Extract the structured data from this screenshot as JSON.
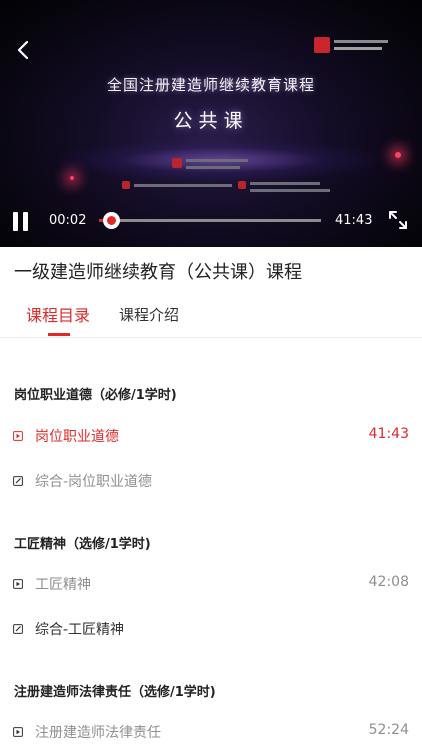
{
  "player": {
    "video_title": "全国注册建造师继续教育课程",
    "video_subtitle": "公共课",
    "current_time": "00:02",
    "total_time": "41:43",
    "progress": 0.01,
    "accent_color": "#e02a2a",
    "icons": {
      "back": "back-arrow-icon",
      "pause": "pause-icon",
      "fullscreen": "fullscreen-icon"
    }
  },
  "course": {
    "title": "一级建造师继续教育（公共课）课程"
  },
  "tabs": [
    {
      "label": "课程目录",
      "active": true
    },
    {
      "label": "课程介绍",
      "active": false
    }
  ],
  "sections": [
    {
      "title": "岗位职业道德（必修/1学时)",
      "lessons": [
        {
          "type": "video",
          "name": "岗位职业道德",
          "duration": "41:43",
          "active": true
        },
        {
          "type": "exam",
          "name": "综合-岗位职业道德",
          "duration": ""
        }
      ]
    },
    {
      "title": "工匠精神（选修/1学时)",
      "lessons": [
        {
          "type": "video",
          "name": "工匠精神",
          "duration": "42:08"
        },
        {
          "type": "exam",
          "name": "综合-工匠精神",
          "duration": ""
        }
      ]
    },
    {
      "title": "注册建造师法律责任（选修/1学时)",
      "lessons": [
        {
          "type": "video",
          "name": "注册建造师法律责任",
          "duration": "52:24"
        }
      ]
    }
  ]
}
